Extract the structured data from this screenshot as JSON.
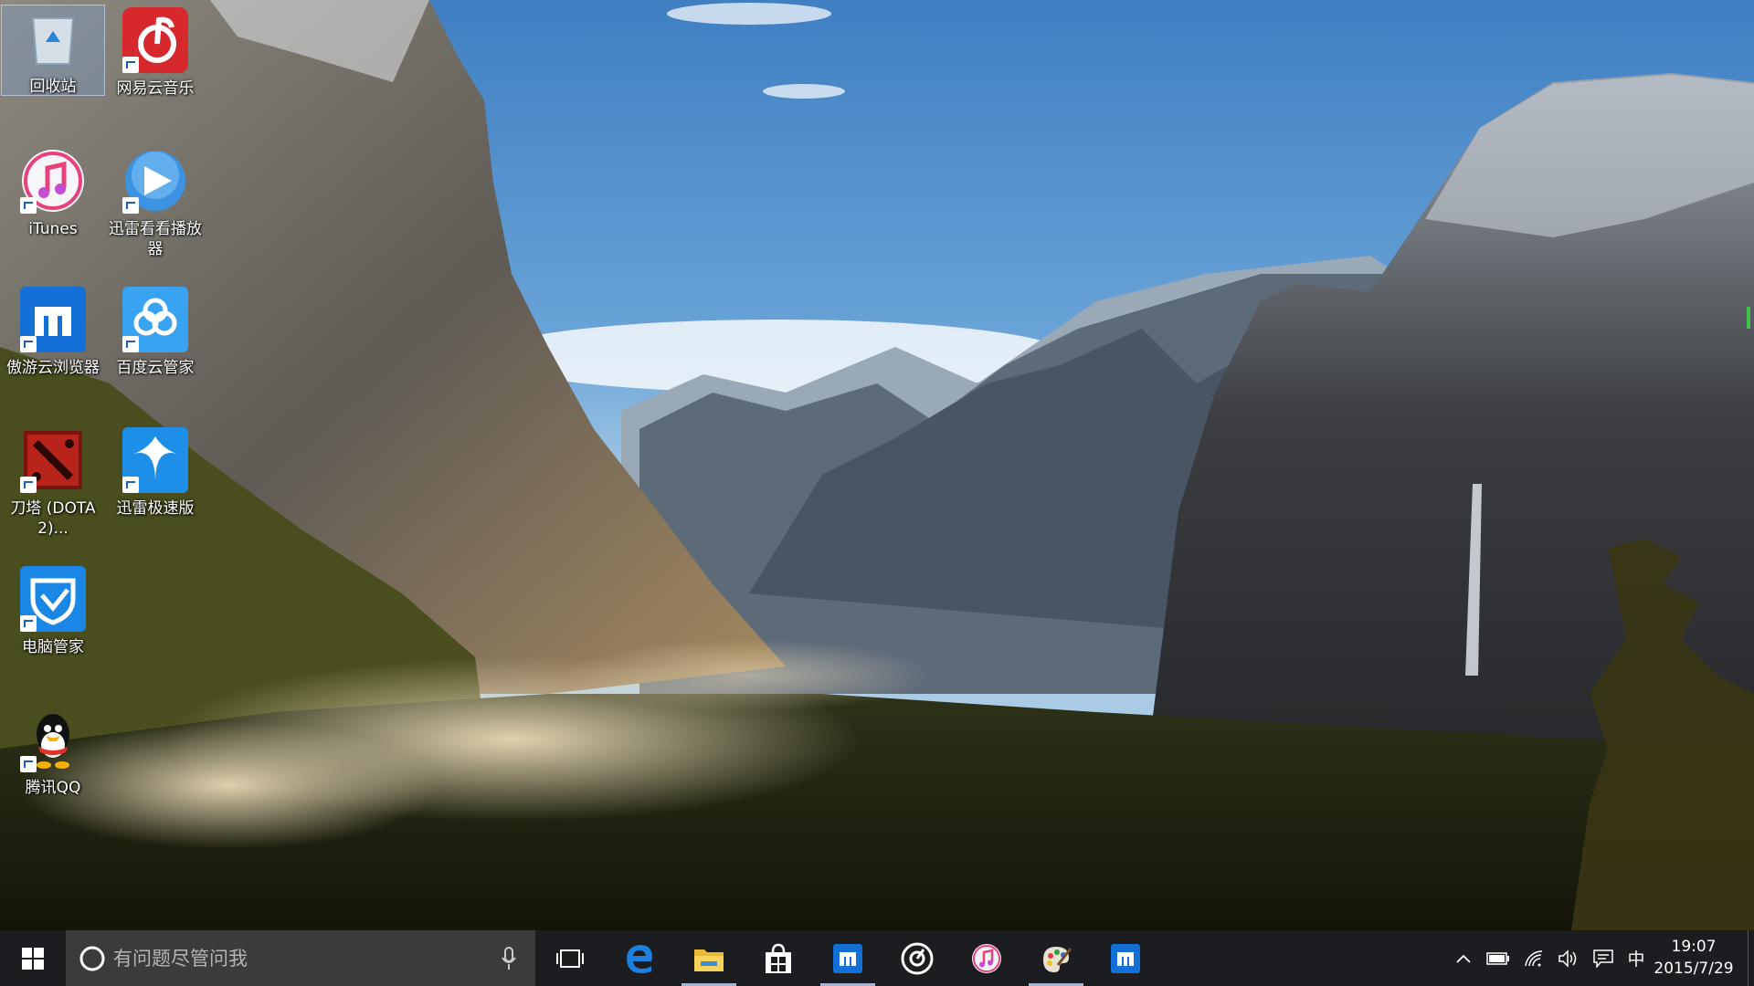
{
  "desktop": {
    "icons": [
      {
        "label": "回收站",
        "name": "recycle-bin-icon"
      },
      {
        "label": "网易云音乐",
        "name": "netease-music-icon"
      },
      {
        "label": "iTunes",
        "name": "itunes-icon"
      },
      {
        "label": "迅雷看看播放器",
        "name": "xunlei-kankan-icon"
      },
      {
        "label": "傲游云浏览器",
        "name": "maxthon-icon"
      },
      {
        "label": "百度云管家",
        "name": "baidu-cloud-icon"
      },
      {
        "label": "刀塔 (DOTA2)...",
        "name": "dota2-icon"
      },
      {
        "label": "迅雷极速版",
        "name": "xunlei-express-icon"
      },
      {
        "label": "电脑管家",
        "name": "pc-manager-icon"
      },
      {
        "label": "腾讯QQ",
        "name": "tencent-qq-icon"
      }
    ]
  },
  "taskbar": {
    "search_placeholder": "有问题尽管问我",
    "apps": [
      {
        "name": "task-view-icon"
      },
      {
        "name": "edge-icon"
      },
      {
        "name": "file-explorer-icon"
      },
      {
        "name": "store-icon"
      },
      {
        "name": "maxthon-icon"
      },
      {
        "name": "music-player-icon"
      },
      {
        "name": "itunes-icon"
      },
      {
        "name": "paint-icon"
      },
      {
        "name": "maxthon-icon"
      }
    ],
    "ime": "中",
    "clock": {
      "time": "19:07",
      "date": "2015/7/29"
    }
  },
  "colors": {
    "taskbar": "#121214",
    "search_box": "#3b3b3d",
    "accent": "#0078d7"
  }
}
